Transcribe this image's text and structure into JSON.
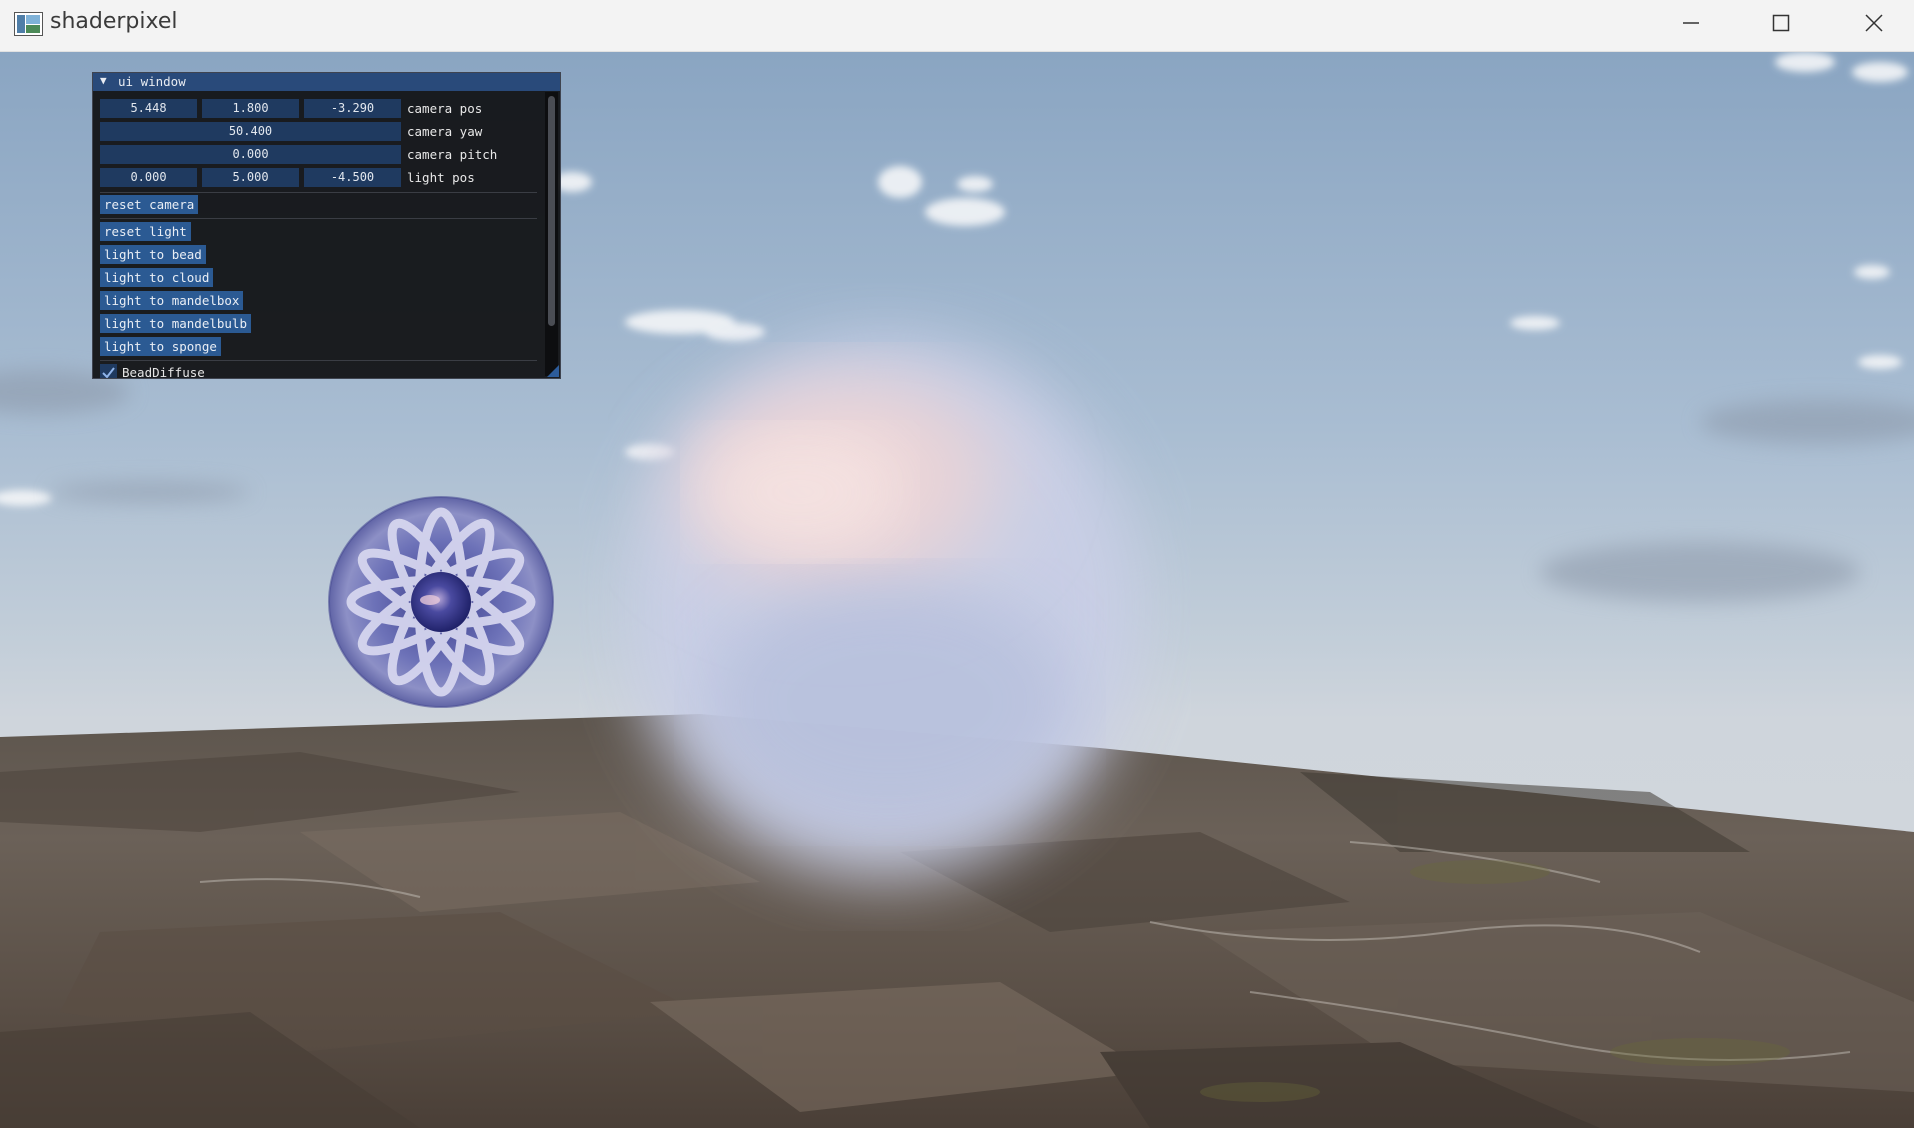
{
  "window": {
    "title": "shaderpixel",
    "controls": [
      "minimize",
      "maximize",
      "close"
    ]
  },
  "ui_window": {
    "title": "ui window",
    "fields": {
      "camera_pos": {
        "values": [
          "5.448",
          "1.800",
          "-3.290"
        ],
        "label": "camera pos"
      },
      "camera_yaw": {
        "value": "50.400",
        "label": "camera yaw"
      },
      "camera_pitch": {
        "value": "0.000",
        "label": "camera pitch"
      },
      "light_pos": {
        "values": [
          "0.000",
          "5.000",
          "-4.500"
        ],
        "label": "light pos"
      }
    },
    "buttons": {
      "reset_camera": "reset camera",
      "reset_light": "reset light",
      "light_to_bead": "light to bead",
      "light_to_cloud": "light to cloud",
      "light_to_mandelbox": "light to mandelbox",
      "light_to_mandelbulb": "light to mandelbulb",
      "light_to_sponge": "light to sponge"
    },
    "checkbox": {
      "label": "BeadDiffuse",
      "checked": true
    }
  },
  "colors": {
    "imgui_header": "#294a7a",
    "imgui_frame": "#1f3a60",
    "imgui_button": "#2b5a93",
    "sky_top": "#8fa9c6",
    "ground": "#5a4f46"
  },
  "icons": [
    "app-icon",
    "minimize-icon",
    "maximize-icon",
    "close-icon",
    "collapse-arrow-icon",
    "checkmark-icon",
    "resize-grip-icon"
  ]
}
